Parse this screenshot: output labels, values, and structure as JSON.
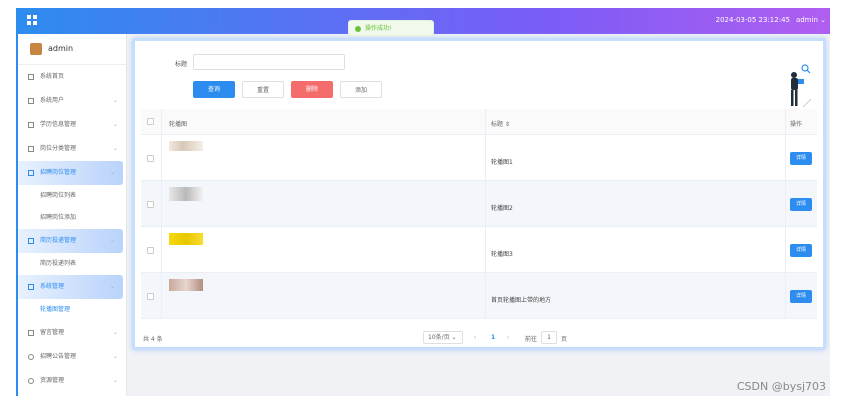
{
  "topbar": {
    "datetime": "2024-03-05 23:12:45",
    "user": "admin",
    "user_chevron": "⌄"
  },
  "toast": {
    "text": "操作成功!",
    "icon": "check-circle-icon",
    "color": "#67c23a"
  },
  "sidebar": {
    "admin_name": "admin",
    "items": [
      {
        "label": "系统首页",
        "icon": "home-icon"
      },
      {
        "label": "系统用户",
        "icon": "user-icon",
        "chevron": "⌄"
      },
      {
        "label": "学历信息管理",
        "icon": "doc-icon",
        "chevron": "⌄"
      },
      {
        "label": "岗位分类管理",
        "icon": "doc-icon",
        "chevron": "⌄"
      },
      {
        "label": "招聘岗位管理",
        "icon": "doc-icon",
        "chevron": "⌄",
        "active": true
      },
      {
        "label": "招聘岗位列表"
      },
      {
        "label": "招聘岗位添加"
      },
      {
        "label": "简历投递管理",
        "icon": "doc-icon",
        "chevron": "⌄",
        "active": true
      },
      {
        "label": "简历投递列表"
      },
      {
        "label": "系统管理",
        "icon": "system-icon",
        "chevron": "⌄",
        "active": true
      },
      {
        "label": "轮播图管理"
      },
      {
        "label": "留言管理",
        "icon": "message-icon",
        "chevron": "⌄"
      },
      {
        "label": "招聘公告管理",
        "icon": "clock-icon",
        "chevron": "⌄"
      },
      {
        "label": "资源管理",
        "icon": "gear-icon",
        "chevron": "⌄"
      }
    ]
  },
  "search": {
    "label": "标题",
    "value": ""
  },
  "buttons": {
    "query": "查询",
    "reset": "重置",
    "delete": "删除",
    "add": "添加"
  },
  "table": {
    "headers": {
      "image": "轮播图",
      "title": "标题 ⇕",
      "ops": "操作"
    },
    "rows": [
      {
        "title": "轮播图1",
        "op": "详情"
      },
      {
        "title": "轮播图2",
        "op": "详情"
      },
      {
        "title": "轮播图3",
        "op": "详情"
      },
      {
        "title": "首页轮播图上带的地方",
        "op": "详情"
      }
    ]
  },
  "pager": {
    "total": "共 4 条",
    "per_page": "10条/页",
    "per_page_chevron": "⌄",
    "prev": "‹",
    "current": "1",
    "next": "›",
    "goto": "前往",
    "goto_value": "1",
    "unit": "页"
  },
  "watermark": "CSDN @bysj703",
  "colors": {
    "primary": "#2d8cf0",
    "danger": "#f56c6c",
    "topbar_end": "#b05ef0"
  }
}
